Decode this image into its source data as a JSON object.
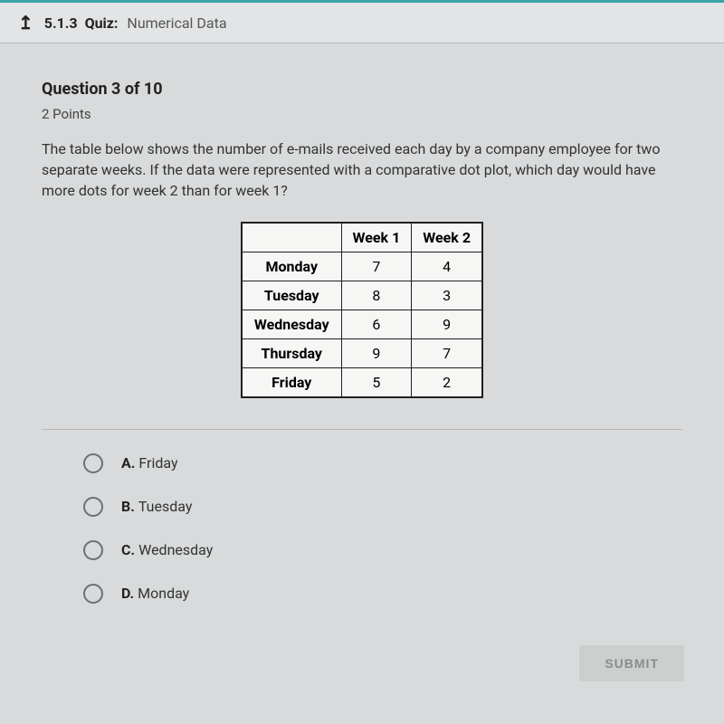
{
  "header": {
    "quiz_code": "5.1.3",
    "quiz_label": "Quiz:",
    "quiz_subject": "Numerical Data"
  },
  "question": {
    "title": "Question 3 of 10",
    "points": "2 Points",
    "prompt": "The table below shows the number of e-mails received each day by a company employee for two separate weeks. If the data were represented with a comparative dot plot, which day would have more dots for week 2 than for week 1?"
  },
  "chart_data": {
    "type": "table",
    "columns": [
      "",
      "Week 1",
      "Week 2"
    ],
    "rows": [
      {
        "day": "Monday",
        "week1": 7,
        "week2": 4
      },
      {
        "day": "Tuesday",
        "week1": 8,
        "week2": 3
      },
      {
        "day": "Wednesday",
        "week1": 6,
        "week2": 9
      },
      {
        "day": "Thursday",
        "week1": 9,
        "week2": 7
      },
      {
        "day": "Friday",
        "week1": 5,
        "week2": 2
      }
    ]
  },
  "options": [
    {
      "letter": "A.",
      "text": "Friday"
    },
    {
      "letter": "B.",
      "text": "Tuesday"
    },
    {
      "letter": "C.",
      "text": "Wednesday"
    },
    {
      "letter": "D.",
      "text": "Monday"
    }
  ],
  "footer": {
    "submit_label": "SUBMIT"
  }
}
